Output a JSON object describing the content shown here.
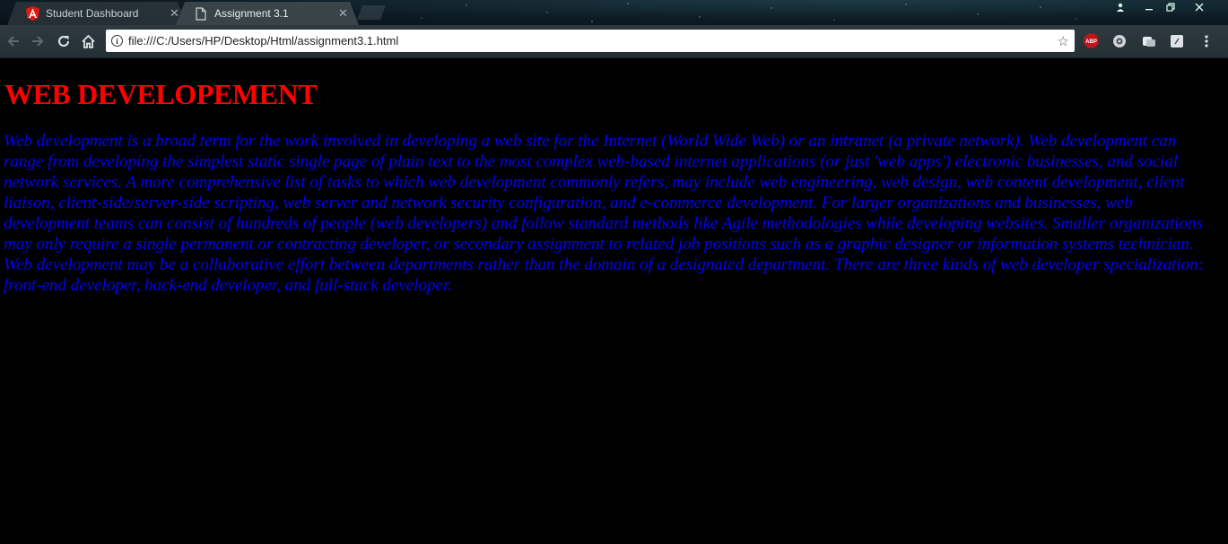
{
  "browser": {
    "tabs": [
      {
        "title": "Student Dashboard",
        "active": false,
        "favicon": "angular-icon"
      },
      {
        "title": "Assignment 3.1",
        "active": true,
        "favicon": "file-icon"
      }
    ],
    "address": "file:///C:/Users/HP/Desktop/Html/assignment3.1.html",
    "extensions": [
      "adblock-plus-icon",
      "extension-icon",
      "extension-icon",
      "extension-icon"
    ]
  },
  "page": {
    "heading": "WEB DEVELOPEMENT",
    "paragraph": "Web development is a broad term for the work involved in developing a web site for the Internet (World Wide Web) or an intranet (a private network). Web development can range from developing the simplest static single page of plain text to the most complex web-based internet applications (or just 'web apps') electronic businesses, and social network services. A more comprehensive list of tasks to which web development commonly refers, may include web engineering, web design, web content development, client liaison, client-side/server-side scripting, web server and network security configuration, and e-commerce development. For larger organizations and businesses, web development teams can consist of hundreds of people (web developers) and follow standard methods like Agile methodologies while developing websites. Smaller organizations may only require a single permanent or contracting developer, or secondary assignment to related job positions such as a graphic designer or information systems technician. Web development may be a collaborative effort between departments rather than the domain of a designated department. There are three kinds of web developer specialization: front-end developer, back-end developer, and full-stack developer."
  },
  "colors": {
    "heading": "#ff0000",
    "paragraph": "#0000ff",
    "background": "#000000"
  }
}
